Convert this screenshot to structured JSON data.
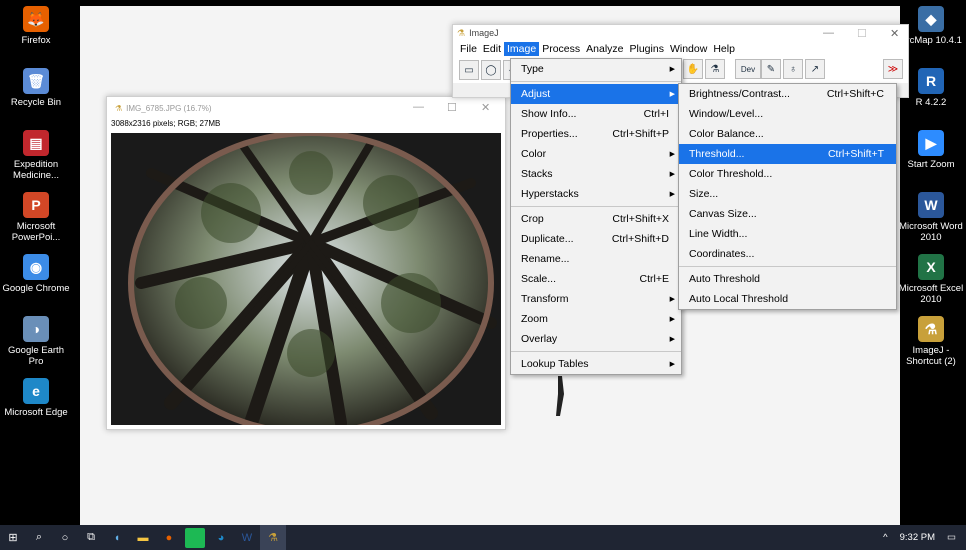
{
  "desktop_left": [
    {
      "label": "Firefox",
      "icon": "firefox-icon",
      "color": "#e66000",
      "glyph": "🦊"
    },
    {
      "label": "Recycle Bin",
      "icon": "recycle-bin-icon",
      "color": "#5b8bd6",
      "glyph": "🗑"
    },
    {
      "label": "Expedition Medicine...",
      "icon": "pdf-icon",
      "color": "#c1272d",
      "glyph": "▤"
    },
    {
      "label": "Microsoft PowerPoi...",
      "icon": "powerpoint-icon",
      "color": "#d24726",
      "glyph": "P"
    },
    {
      "label": "Google Chrome",
      "icon": "chrome-icon",
      "color": "#3c8ce7",
      "glyph": "◉"
    },
    {
      "label": "Google Earth Pro",
      "icon": "google-earth-icon",
      "color": "#6a8fb8",
      "glyph": "◑"
    },
    {
      "label": "Microsoft Edge",
      "icon": "edge-icon",
      "color": "#1e88c8",
      "glyph": "e"
    }
  ],
  "desktop_right": [
    {
      "label": "ArcMap 10.4.1",
      "icon": "arcmap-icon",
      "color": "#3a6ea5",
      "glyph": "◆"
    },
    {
      "label": "R 4.2.2",
      "icon": "r-icon",
      "color": "#2165b6",
      "glyph": "R"
    },
    {
      "label": "Start Zoom",
      "icon": "zoom-icon",
      "color": "#2d8cff",
      "glyph": "▶"
    },
    {
      "label": "Microsoft Word 2010",
      "icon": "word-icon",
      "color": "#2b579a",
      "glyph": "W"
    },
    {
      "label": "Microsoft Excel 2010",
      "icon": "excel-icon",
      "color": "#217346",
      "glyph": "X"
    },
    {
      "label": "ImageJ - Shortcut (2)",
      "icon": "imagej-shortcut-icon",
      "color": "#c8a03a",
      "glyph": "⚗"
    }
  ],
  "image_window": {
    "title": "IMG_6785.JPG (16.7%)",
    "info": "3088x2316 pixels; RGB; 27MB"
  },
  "imagej": {
    "title": "ImageJ",
    "menus": [
      "File",
      "Edit",
      "Image",
      "Process",
      "Analyze",
      "Plugins",
      "Window",
      "Help"
    ],
    "active_menu": "Image",
    "dev_label": "Dev",
    "more_label": "≫"
  },
  "image_menu": [
    {
      "label": "Type",
      "shortcut": "",
      "submenu": true
    },
    {
      "sep": true
    },
    {
      "label": "Adjust",
      "shortcut": "",
      "submenu": true,
      "highlight": true
    },
    {
      "label": "Show Info...",
      "shortcut": "Ctrl+I"
    },
    {
      "label": "Properties...",
      "shortcut": "Ctrl+Shift+P"
    },
    {
      "label": "Color",
      "shortcut": "",
      "submenu": true
    },
    {
      "label": "Stacks",
      "shortcut": "",
      "submenu": true
    },
    {
      "label": "Hyperstacks",
      "shortcut": "",
      "submenu": true
    },
    {
      "sep": true
    },
    {
      "label": "Crop",
      "shortcut": "Ctrl+Shift+X"
    },
    {
      "label": "Duplicate...",
      "shortcut": "Ctrl+Shift+D"
    },
    {
      "label": "Rename...",
      "shortcut": ""
    },
    {
      "label": "Scale...",
      "shortcut": "Ctrl+E"
    },
    {
      "label": "Transform",
      "shortcut": "",
      "submenu": true
    },
    {
      "label": "Zoom",
      "shortcut": "",
      "submenu": true
    },
    {
      "label": "Overlay",
      "shortcut": "",
      "submenu": true
    },
    {
      "sep": true
    },
    {
      "label": "Lookup Tables",
      "shortcut": "",
      "submenu": true
    }
  ],
  "adjust_menu": [
    {
      "label": "Brightness/Contrast...",
      "shortcut": "Ctrl+Shift+C"
    },
    {
      "label": "Window/Level...",
      "shortcut": ""
    },
    {
      "label": "Color Balance...",
      "shortcut": ""
    },
    {
      "label": "Threshold...",
      "shortcut": "Ctrl+Shift+T",
      "highlight": true
    },
    {
      "label": "Color Threshold...",
      "shortcut": ""
    },
    {
      "label": "Size...",
      "shortcut": ""
    },
    {
      "label": "Canvas Size...",
      "shortcut": ""
    },
    {
      "label": "Line Width...",
      "shortcut": ""
    },
    {
      "label": "Coordinates...",
      "shortcut": ""
    },
    {
      "sep": true
    },
    {
      "label": "Auto Threshold",
      "shortcut": ""
    },
    {
      "label": "Auto Local Threshold",
      "shortcut": ""
    }
  ],
  "taskbar": {
    "time": "9:32 PM",
    "chevron": "^"
  }
}
